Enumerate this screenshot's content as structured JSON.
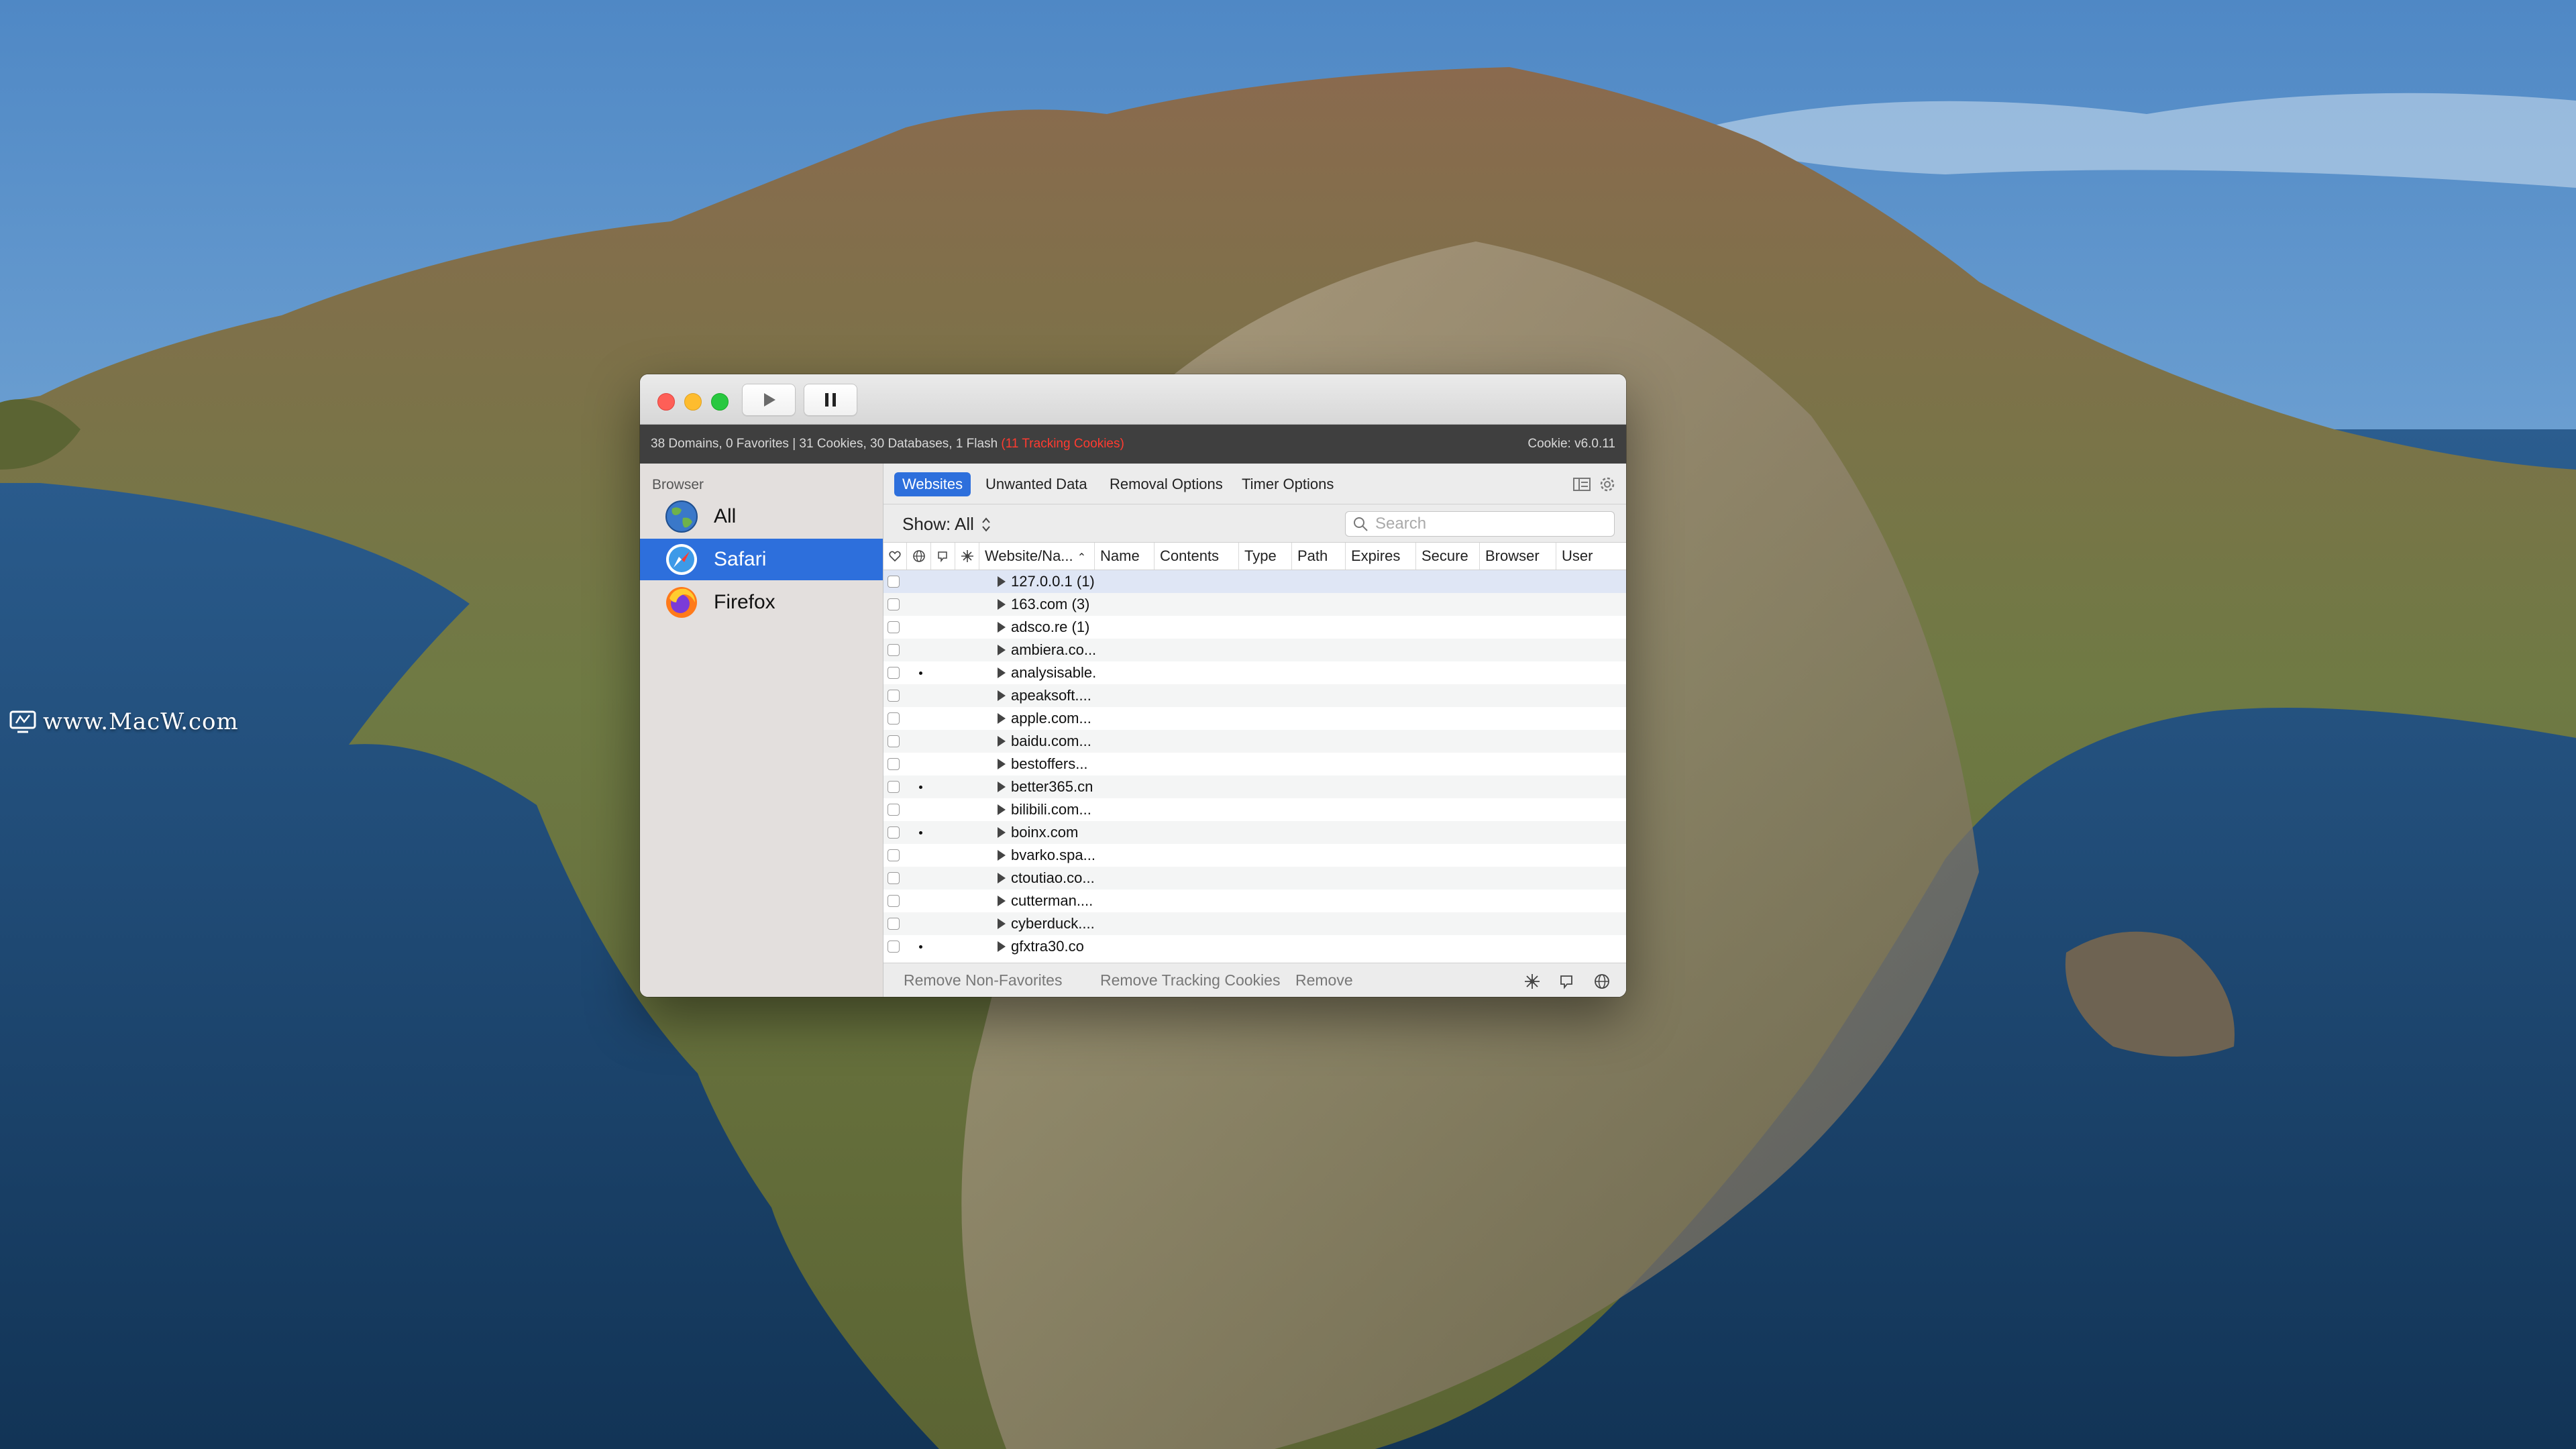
{
  "desktop": {
    "watermark": "www.MacW.com"
  },
  "window": {
    "controls": {
      "close": "close",
      "minimize": "minimize",
      "zoom": "zoom"
    },
    "toolbar": {
      "play_icon": "play-icon",
      "pause_icon": "pause-icon"
    },
    "status": {
      "summary": "38 Domains, 0 Favorites | 31 Cookies, 30 Databases, 1 Flash",
      "tracking": "(11 Tracking Cookies)",
      "version": "Cookie: v6.0.11"
    }
  },
  "sidebar": {
    "header": "Browser",
    "items": [
      {
        "label": "All",
        "icon": "globe-icon",
        "selected": false
      },
      {
        "label": "Safari",
        "icon": "safari-compass-icon",
        "selected": true
      },
      {
        "label": "Firefox",
        "icon": "firefox-icon",
        "selected": false
      }
    ]
  },
  "tabs": [
    {
      "label": "Websites",
      "active": true
    },
    {
      "label": "Unwanted Data",
      "active": false
    },
    {
      "label": "Removal Options",
      "active": false
    },
    {
      "label": "Timer Options",
      "active": false
    }
  ],
  "filter": {
    "show_label": "Show: All",
    "search_placeholder": "Search"
  },
  "columns": {
    "favorite_icon": "heart-icon",
    "globe_icon": "globe-icon",
    "flash_icon": "flash-icon",
    "tracking_icon": "tracking-icon",
    "website": "Website/Na...",
    "name": "Name",
    "contents": "Contents",
    "type": "Type",
    "path": "Path",
    "expires": "Expires",
    "secure": "Secure",
    "browser": "Browser",
    "user": "User"
  },
  "rows": [
    {
      "site": "127.0.0.1 (1)",
      "dot": false
    },
    {
      "site": "163.com (3)",
      "dot": false
    },
    {
      "site": "adsco.re (1)",
      "dot": false
    },
    {
      "site": "ambiera.co...",
      "dot": false
    },
    {
      "site": "analysisable.",
      "dot": true
    },
    {
      "site": "apeaksoft....",
      "dot": false
    },
    {
      "site": "apple.com...",
      "dot": false
    },
    {
      "site": "baidu.com...",
      "dot": false
    },
    {
      "site": "bestoffers...",
      "dot": false
    },
    {
      "site": "better365.cn",
      "dot": true
    },
    {
      "site": "bilibili.com...",
      "dot": false
    },
    {
      "site": "boinx.com",
      "dot": true
    },
    {
      "site": "bvarko.spa...",
      "dot": false
    },
    {
      "site": "ctoutiao.co...",
      "dot": false
    },
    {
      "site": "cutterman....",
      "dot": false
    },
    {
      "site": "cyberduck....",
      "dot": false
    },
    {
      "site": "gfxtra30.co",
      "dot": true
    }
  ],
  "bottom": {
    "remove_non_favorites": "Remove Non-Favorites",
    "remove_tracking": "Remove Tracking Cookies",
    "remove": "Remove"
  },
  "colors": {
    "accent": "#2d6fdc",
    "tracking_red": "#ff3b30",
    "status_bar": "#3f3f3f"
  }
}
